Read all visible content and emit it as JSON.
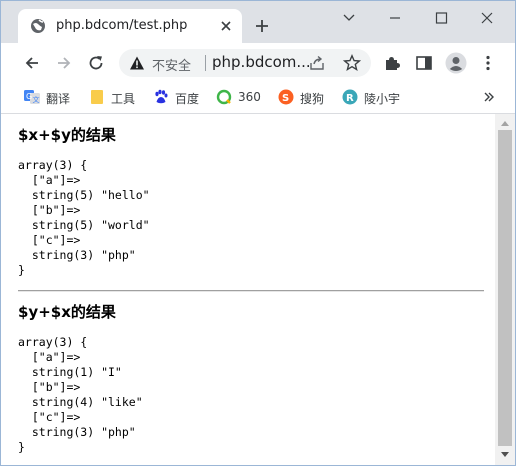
{
  "tab": {
    "title": "php.bdcom/test.php",
    "favicon": "globe-icon",
    "close_icon": "close-icon"
  },
  "new_tab_icon": "plus-icon",
  "window_controls": [
    "chevron-down-icon",
    "minimize-icon",
    "maximize-icon",
    "close-icon"
  ],
  "toolbar": {
    "back_icon": "back-arrow-icon",
    "forward_icon": "forward-arrow-icon",
    "reload_icon": "reload-icon",
    "omnibox": {
      "security_label": "不安全",
      "url": "php.bdcom...",
      "warning_icon": "warning-triangle-icon",
      "share_icon": "share-icon",
      "star_icon": "star-icon"
    },
    "extensions_icon": "puzzle-icon",
    "sidepanel_icon": "side-panel-icon",
    "profile_icon": "profile-icon",
    "menu_icon": "kebab-menu-icon"
  },
  "bookmarks": [
    {
      "label": "翻译",
      "icon": "translate-icon",
      "color": "#4285f4"
    },
    {
      "label": "工具",
      "icon": "folder-icon",
      "color": "#f9cc4b"
    },
    {
      "label": "百度",
      "icon": "baidu-paw-icon",
      "color": "#2932e1"
    },
    {
      "label": "360",
      "icon": "360-icon",
      "color": "#3fb549"
    },
    {
      "label": "搜狗",
      "icon": "sogou-icon",
      "color": "#fb6022"
    },
    {
      "label": "陵小宇",
      "icon": "site-icon",
      "color": "#3aa7b8"
    }
  ],
  "bookmarks_more_icon": "chevron-double-right-icon",
  "page": {
    "sections": [
      {
        "heading": "$x+$y的结果",
        "dump": "array(3) {\n  [\"a\"]=>\n  string(5) \"hello\"\n  [\"b\"]=>\n  string(5) \"world\"\n  [\"c\"]=>\n  string(3) \"php\"\n}"
      },
      {
        "heading": "$y+$x的结果",
        "dump": "array(3) {\n  [\"a\"]=>\n  string(1) \"I\"\n  [\"b\"]=>\n  string(4) \"like\"\n  [\"c\"]=>\n  string(3) \"php\"\n}"
      }
    ]
  },
  "colors": {
    "tabstrip_bg": "#dee1e6",
    "omnibox_bg": "#f1f3f4",
    "scroll_thumb": "#c1c1c1"
  }
}
